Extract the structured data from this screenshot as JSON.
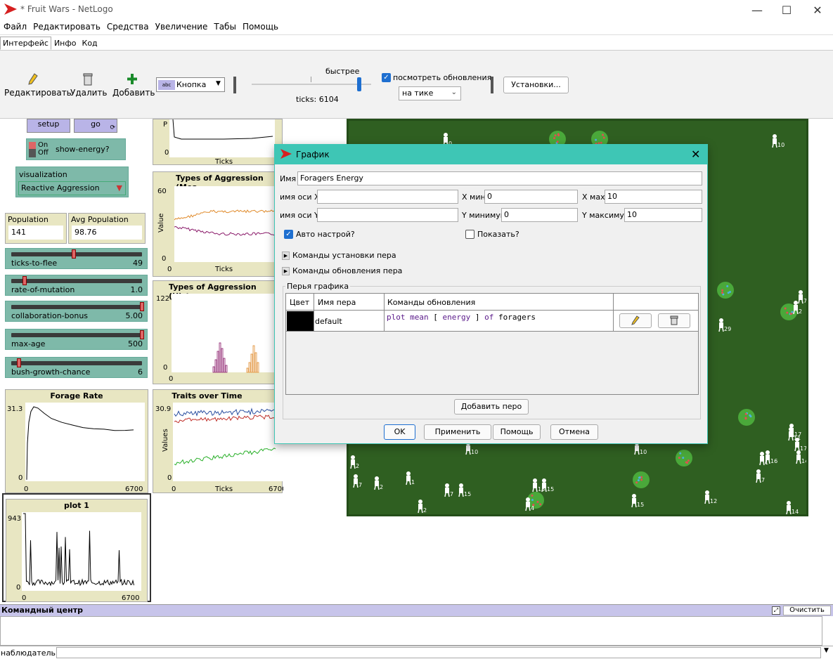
{
  "window": {
    "title": "* Fruit Wars - NetLogo",
    "minimize": "—",
    "maximize": "☐",
    "close": "✕"
  },
  "menu": [
    "Файл",
    "Редактировать",
    "Средства",
    "Увеличение",
    "Табы",
    "Помощь"
  ],
  "tabs": [
    "Интерфейс",
    "Инфо",
    "Код"
  ],
  "toolbar": {
    "edit": "Редактировать",
    "delete": "Удалить",
    "add": "Добавить",
    "widget_type": "Кнопка",
    "speed_label": "быстрее",
    "ticks": "ticks: 6104",
    "view_updates": "посмотреть обновления",
    "update_mode": "на тике",
    "settings": "Установки..."
  },
  "widgets": {
    "setup": "setup",
    "go": "go",
    "switch_on": "On",
    "switch_off": "Off",
    "switch_label": "show-energy?",
    "chooser_label": "visualization",
    "chooser_value": "Reactive Aggression",
    "population_label": "Population",
    "population_value": "141",
    "avg_population_label": "Avg Population",
    "avg_population_value": "98.76",
    "sliders": [
      {
        "label": "ticks-to-flee",
        "value": "49",
        "level": 0.48
      },
      {
        "label": "rate-of-mutation",
        "value": "1.0",
        "level": 0.1
      },
      {
        "label": "collaboration-bonus",
        "value": "5.00",
        "level": 1.0
      },
      {
        "label": "max-age",
        "value": "500",
        "level": 1.0
      },
      {
        "label": "bush-growth-chance",
        "value": "6",
        "level": 0.06
      }
    ]
  },
  "plots": {
    "top_partial": {
      "xlabel": "Ticks",
      "ymin": "0",
      "ylabel_fragment": "P"
    },
    "aggression_mean": {
      "title": "Types of Aggression (Mea",
      "ylabel": "Value",
      "ymax": "60",
      "ymin": "0",
      "xmin": "0",
      "xlabel": "Ticks"
    },
    "aggression_hist": {
      "title": "Types of Aggression (Histo",
      "ymax": "122",
      "ymin": "0",
      "xmin": "0"
    },
    "forage_rate": {
      "title": "Forage Rate",
      "ymax": "31.3",
      "ymin": "0",
      "xmin": "0",
      "xmax": "6700"
    },
    "traits": {
      "title": "Traits over Time",
      "ylabel": "Values",
      "ymax": "30.9",
      "ymin": "0",
      "xmin": "0",
      "xmax": "6700",
      "xlabel": "Ticks"
    },
    "plot1": {
      "title": "plot 1",
      "ymax": "943",
      "ymin": "0",
      "xmin": "0",
      "xmax": "6700"
    }
  },
  "world": {
    "agent_labels": [
      "0",
      "10",
      "29",
      "7",
      "17",
      "17",
      "14",
      "10",
      "10",
      "2",
      "7",
      "2",
      "1",
      "7",
      "15",
      "15",
      "15",
      "4",
      "15",
      "12",
      "2",
      "1",
      "16",
      "7",
      "14",
      "11",
      "2"
    ]
  },
  "dialog": {
    "title": "График",
    "name_label": "Имя",
    "name_value": "Foragers Energy",
    "xaxis_label": "имя оси X",
    "xaxis_value": "",
    "xmin_label": "X мин",
    "xmin_value": "0",
    "xmax_label": "X мах",
    "xmax_value": "10",
    "yaxis_label": "имя оси Y",
    "yaxis_value": "",
    "ymin_label": "Y минимум",
    "ymin_value": "0",
    "ymax_label": "Y максимум",
    "ymax_value": "10",
    "autoscale_label": "Авто настрой?",
    "show_legend_label": "Показать?",
    "pen_setup_label": "Команды установки пера",
    "pen_update_label": "Команды обновления пера",
    "pens_group": "Перья графика",
    "col_color": "Цвет",
    "col_pen_name": "Имя пера",
    "col_update": "Команды обновления",
    "pen_row": {
      "name": "default",
      "code_parts": [
        "plot",
        "mean",
        "[",
        "energy",
        "]",
        "of",
        "foragers"
      ],
      "color": "#000000"
    },
    "add_pen": "Добавить перо",
    "ok": "OK",
    "apply": "Применить",
    "help": "Помощь",
    "cancel": "Отмена"
  },
  "command_center": {
    "title": "Командный центр",
    "clear": "Очистить",
    "observer": "наблюдатель>"
  },
  "colors": {
    "accent": "#3ec6b5",
    "button": "#b9b4e7",
    "slider": "#7eb9a9",
    "monitor": "#e8e6c2",
    "world": "#2f5f21"
  }
}
